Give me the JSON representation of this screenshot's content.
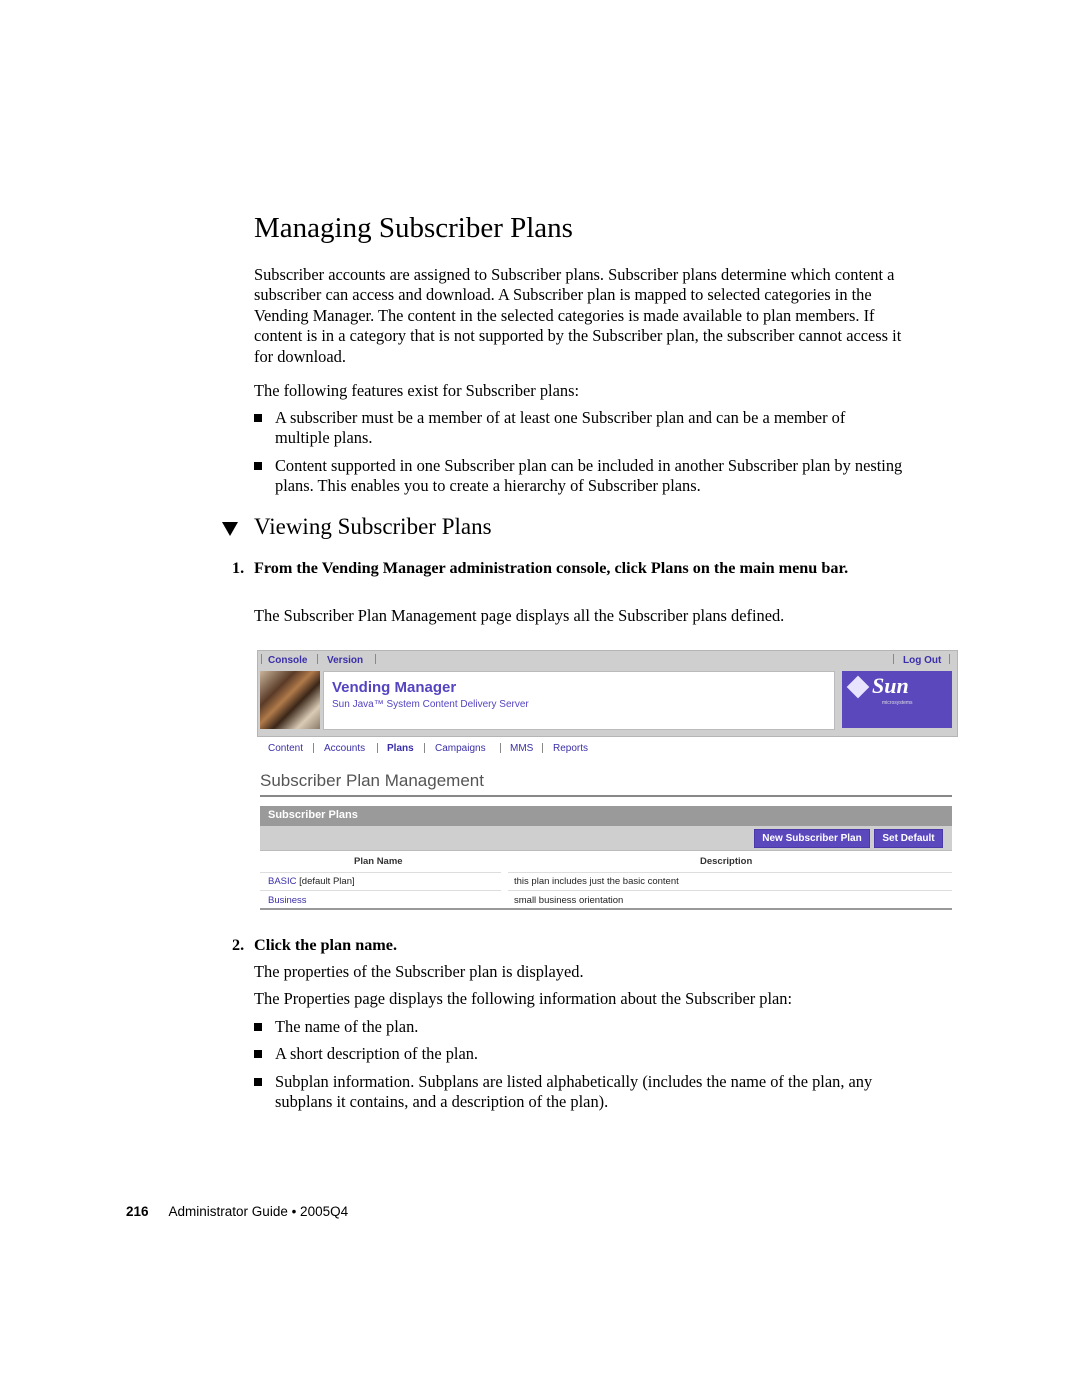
{
  "title": "Managing Subscriber Plans",
  "intro": "Subscriber accounts are assigned to Subscriber plans. Subscriber plans determine which content a subscriber can access and download. A Subscriber plan is mapped to selected categories in the Vending Manager. The content in the selected categories is made available to plan members. If content is in a category that is not supported by the Subscriber plan, the subscriber cannot access it for download.",
  "features_lead": "The following features exist for Subscriber plans:",
  "features": [
    "A subscriber must be a member of at least one Subscriber plan and can be a member of multiple plans.",
    "Content supported in one Subscriber plan can be included in another Subscriber plan by nesting plans. This enables you to create a hierarchy of Subscriber plans."
  ],
  "section_title": "Viewing Subscriber Plans",
  "steps": [
    {
      "num": "1.",
      "text": "From the Vending Manager administration console, click Plans on the main menu bar.",
      "result": "The Subscriber Plan Management page displays all the Subscriber plans defined."
    },
    {
      "num": "2.",
      "text": "Click the plan name.",
      "result": "The properties of the Subscriber plan is displayed."
    }
  ],
  "properties_lead": "The Properties page displays the following information about the Subscriber plan:",
  "properties": [
    "The name of the plan.",
    "A short description of the plan.",
    "Subplan information. Subplans are listed alphabetically (includes the name of the plan, any subplans it contains, and a description of the plan)."
  ],
  "screenshot": {
    "top_links": [
      "Console",
      "Version"
    ],
    "logout": "Log Out",
    "app_title": "Vending Manager",
    "app_subtitle": "Sun Java™ System Content Delivery Server",
    "logo_word": "Sun",
    "logo_sub": "microsystems",
    "nav": [
      "Content",
      "Accounts",
      "Plans",
      "Campaigns",
      "MMS",
      "Reports"
    ],
    "nav_active": "Plans",
    "page_title": "Subscriber Plan Management",
    "table_title": "Subscriber Plans",
    "buttons": {
      "new_plan": "New Subscriber Plan",
      "set_default": "Set Default"
    },
    "columns": [
      "Plan Name",
      "Description"
    ],
    "rows": [
      {
        "name": "BASIC",
        "note": "[default Plan]",
        "description": "this plan includes just the basic content"
      },
      {
        "name": "Business",
        "note": "",
        "description": "small business orientation"
      }
    ],
    "colors": {
      "accent": "#5b48bd",
      "link": "#3a2fa8"
    }
  },
  "footer": {
    "page_number": "216",
    "text": "Administrator Guide • 2005Q4"
  }
}
